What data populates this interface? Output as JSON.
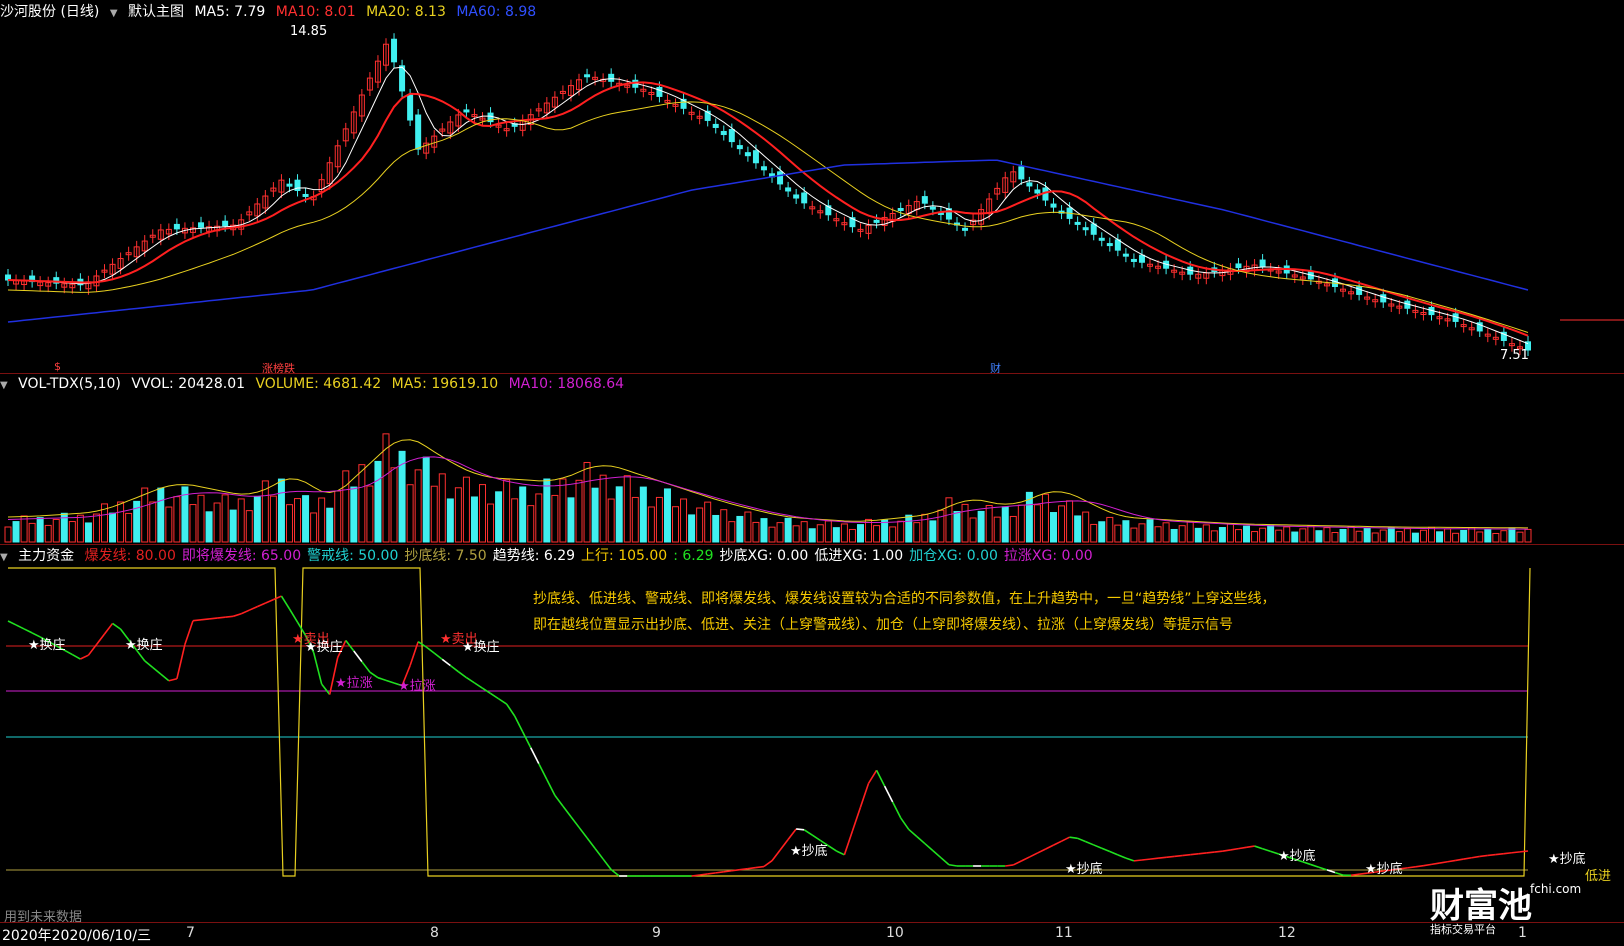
{
  "main": {
    "stock": "沙河股份 (日线)",
    "template": "默认主图",
    "ma5": "MA5: 7.79",
    "ma10": "MA10: 8.01",
    "ma20": "MA20: 8.13",
    "ma60": "MA60: 8.98",
    "high_label": "14.85",
    "low_label": "7.51",
    "badge_left": "$",
    "badge_mid": "涨榜跌",
    "badge_right": "财"
  },
  "volume": {
    "name": "VOL-TDX(5,10)",
    "vvol": "VVOL: 20428.01",
    "volume": "VOLUME: 4681.42",
    "ma5": "MA5: 19619.10",
    "ma10": "MA10: 18068.64"
  },
  "indicator": {
    "name": "主力资金",
    "items": [
      {
        "text": "爆发线: 80.00",
        "color": "#e02020"
      },
      {
        "text": "即将爆发线: 65.00",
        "color": "#d020d0"
      },
      {
        "text": "警戒线: 50.00",
        "color": "#20d0d0"
      },
      {
        "text": "抄底线: 7.50",
        "color": "#b0a040"
      },
      {
        "text": "趋势线: 6.29",
        "color": "#ffffff"
      },
      {
        "text": "上行: 105.00",
        "color": "#f5c900"
      },
      {
        "text": ": 6.29",
        "color": "#20e020"
      },
      {
        "text": "抄底XG: 0.00",
        "color": "#ffffff"
      },
      {
        "text": "低进XG: 1.00",
        "color": "#ffffff"
      },
      {
        "text": "加仓XG: 0.00",
        "color": "#20d0d0"
      },
      {
        "text": "拉涨XG: 0.00",
        "color": "#d020d0"
      }
    ],
    "note_line1": "抄底线、低进线、警戒线、即将爆发线、爆发线设置较为合适的不同参数值，在上升趋势中，一旦“趋势线”上穿这些线，",
    "note_line2": "即在越线位置显示出抄底、低进、关注（上穿警戒线）、加仓（上穿即将爆发线）、拉涨（上穿爆发线）等提示信号",
    "labels": {
      "huanzhuang": "★换庄",
      "maichu": "★卖出",
      "lazhang": "★拉涨",
      "chaodi": "★抄底",
      "dijin": "低进"
    }
  },
  "footer": {
    "future": "用到未来数据",
    "date": "2020年2020/06/10/三",
    "ticks": [
      "7",
      "8",
      "9",
      "10",
      "11",
      "12",
      "1"
    ]
  },
  "logo": {
    "text": "财富池",
    "sub": "指标交易平台",
    "site": "fchi.com"
  },
  "colors": {
    "up": "#ff3030",
    "down": "#40f0f0",
    "ma5": "#ffffff",
    "ma10": "#ff2020",
    "ma20": "#e8d020",
    "ma60": "#2030e0"
  }
}
